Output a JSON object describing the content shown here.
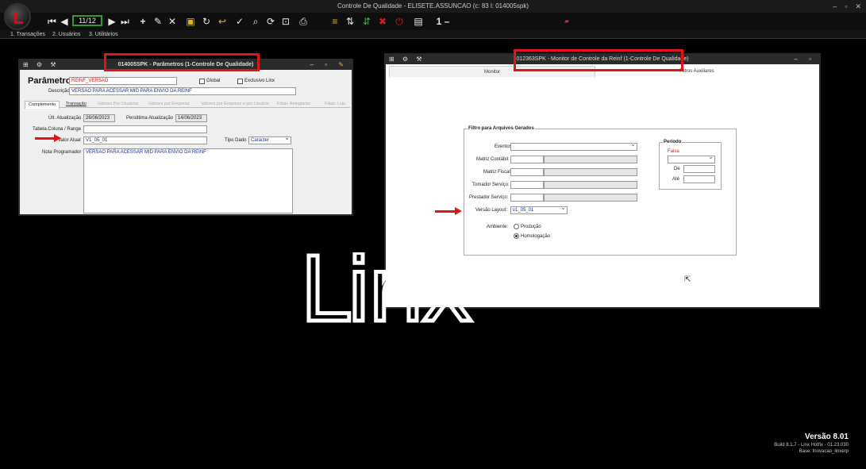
{
  "app": {
    "title": "Controle De Qualidade - ELISETE.ASSUNCAO (c: 83 l: 014005spk)",
    "window_controls": [
      "–",
      "▫",
      "✕"
    ],
    "pager": "11/12",
    "toolbar_extra": "1 –",
    "toolbar_icons": [
      "first-icon",
      "prev-icon",
      "next-icon",
      "last-icon",
      "add-icon",
      "edit-icon",
      "delete-icon",
      "save-icon",
      "refresh-icon",
      "undo-icon",
      "clear-icon",
      "search-icon",
      "reload-icon",
      "zoom-icon",
      "print-icon",
      "report-icon",
      "transfer-icon",
      "export-icon",
      "power-icon",
      "display-icon"
    ],
    "menu": [
      "1. Transações",
      "2. Usuários",
      "3. Utilitários"
    ]
  },
  "params_window": {
    "title": "014005SPK - Parâmetros (1-Controle De Qualidade)",
    "heading": "Parâmetro",
    "param_value": "REINF_VERSAO",
    "global_label": "Global",
    "exclusivo_label": "Exclusivo Linx",
    "descricao_label": "Descrição",
    "descricao_value": "VERSÃO PARA ACESSAR MID PARA ENVIO DA REINF",
    "tabs": [
      "Complemento",
      "Transação",
      "Valores Por Usuários",
      "Valores por Empresa",
      "Valores por Empresa e por Usuário",
      "Filiais Relegiante",
      "Filiais Loja"
    ],
    "ult_atualizacao_label": "Últ. Atualização",
    "ult_atualizacao_value": "26/06/2023",
    "penultima_label": "Penúltima Atualização",
    "penultima_value": "14/06/2023",
    "tabela_label": "Tabela.Coluna / Range",
    "valor_atual_label": "Valor Atual",
    "valor_atual_value": "V1_05_01",
    "tipo_dado_label": "Tipo Dado",
    "tipo_dado_value": "Caracter",
    "nota_label": "Nota Programador",
    "nota_value": "VERSÃO PARA ACESSAR MID PARA ENVIO DA REINF"
  },
  "monitor_window": {
    "title": "012363SPK - Monitor de Controle da Reinf (1-Controle De Qualidade)",
    "tabs": [
      "Monitor",
      "Filtros Auxiliares"
    ],
    "group_title": "Filtro para Arquivos Gerados",
    "eventos_label": "Eventos:",
    "matriz_contabil_label": "Matriz Contábil:",
    "matriz_fiscal_label": "Matriz Fiscal:",
    "tomador_label": "Tomador Serviço:",
    "prestador_label": "Prestador Serviço:",
    "versao_label": "Versão Layout:",
    "versao_value": "v1_05_01",
    "ambiente_label": "Ambiente:",
    "producao_label": "Produção",
    "homologacao_label": "Homologação",
    "periodo_title": "Período",
    "faixa_label": "Faixa",
    "de_label": "De",
    "ate_label": "Até"
  },
  "branding": {
    "logo_text": "Linx",
    "version": "Versão  8.01",
    "build": "Build 8.1.7 - Linx Hotfix - 01.23.030",
    "base": "Base: Inovacao_linxerp"
  },
  "colors": {
    "highlight": "#e0151a",
    "field_text": "#1b2fa0",
    "accent_red": "#d01a1a"
  }
}
